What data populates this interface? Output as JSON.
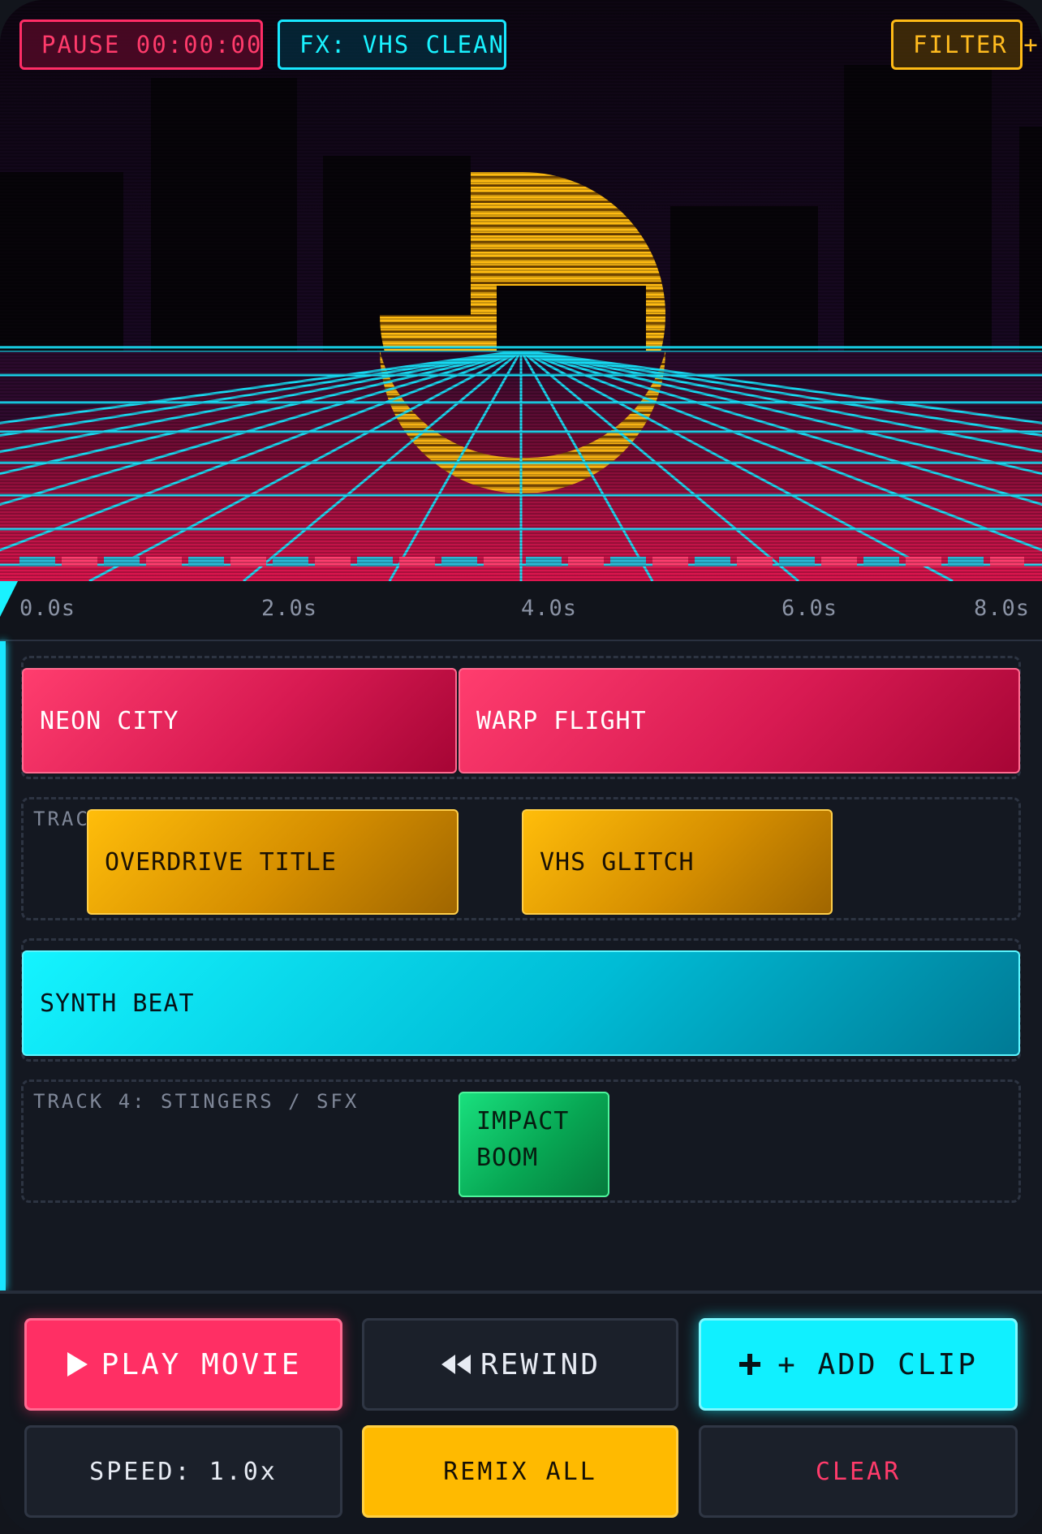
{
  "preview": {
    "pause_label": "PAUSE 00:00:00",
    "fx_label": "FX: VHS CLEAN",
    "filter_label": "FILTER +"
  },
  "ruler": {
    "ticks": [
      "0.0s",
      "2.0s",
      "4.0s",
      "6.0s",
      "8.0s"
    ]
  },
  "tracks": [
    {
      "label": "",
      "clips": [
        {
          "label": "NEON CITY"
        },
        {
          "label": "WARP FLIGHT"
        }
      ]
    },
    {
      "label": "TRAC",
      "clips": [
        {
          "label": "OVERDRIVE TITLE"
        },
        {
          "label": "VHS GLITCH"
        }
      ]
    },
    {
      "label": "",
      "clips": [
        {
          "label": "SYNTH BEAT"
        }
      ]
    },
    {
      "label": "TRACK 4: STINGERS / SFX",
      "clips": [
        {
          "label": "IMPACT BOOM"
        }
      ]
    }
  ],
  "controls": {
    "play_label": "PLAY MOVIE",
    "rewind_label": "REWIND",
    "add_label": "+ ADD CLIP",
    "speed_label": "SPEED: 1.0x",
    "remix_label": "REMIX ALL",
    "clear_label": "CLEAR"
  },
  "icons": {
    "play": "play-icon",
    "rewind": "rewind-icon",
    "add": "plus-icon"
  },
  "colors": {
    "pink": "#ff2f64",
    "cyan": "#10f0ff",
    "yellow": "#ffba00",
    "green": "#07a653",
    "background": "#141821"
  }
}
